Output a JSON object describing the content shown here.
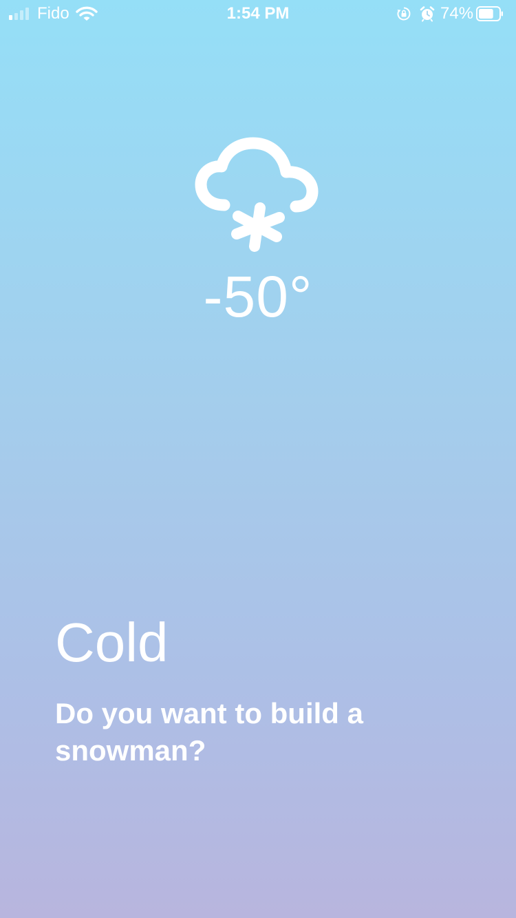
{
  "status_bar": {
    "carrier": "Fido",
    "time": "1:54 PM",
    "battery_percent": "74%",
    "battery_level": 0.74,
    "signal_bars_active": 1,
    "signal_bars_total": 4
  },
  "weather": {
    "icon": "snow-cloud-icon",
    "temperature": "-50°",
    "condition": "Cold",
    "message": "Do you want to build a snowman?"
  },
  "colors": {
    "gradient_top": "#95dff7",
    "gradient_bottom": "#b8b5de",
    "text": "#ffffff"
  }
}
